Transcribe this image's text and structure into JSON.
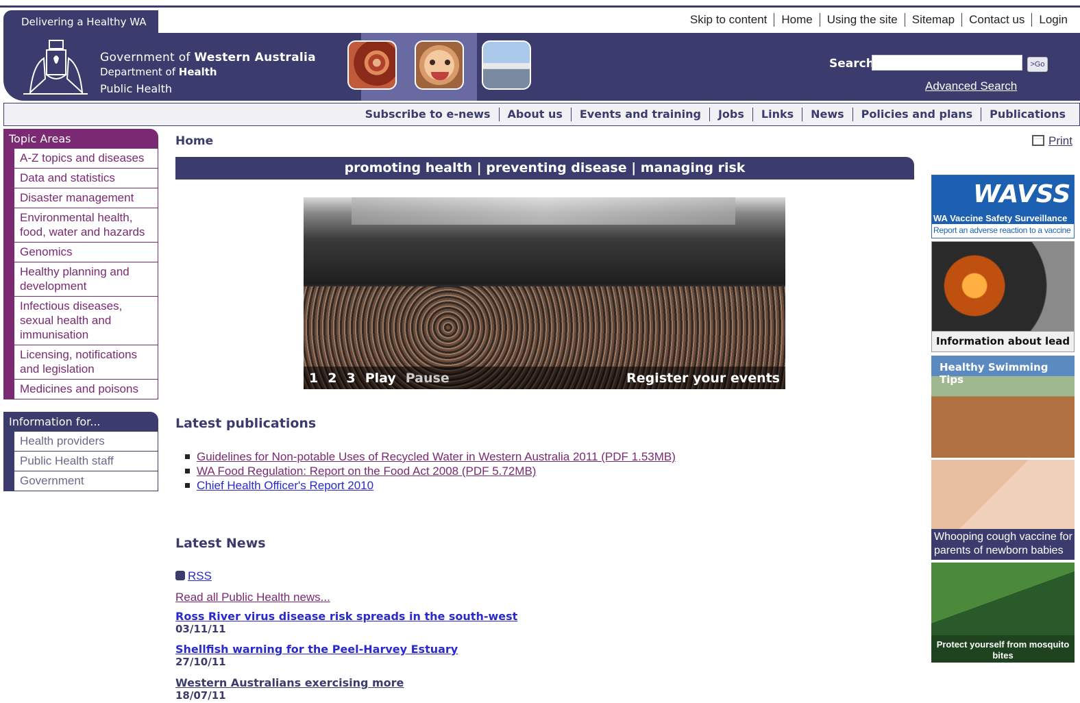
{
  "tagline": "Delivering a Healthy WA",
  "utility_nav": [
    "Skip to content",
    "Home",
    "Using the site",
    "Sitemap",
    "Contact us",
    "Login"
  ],
  "header": {
    "gov_line1_prefix": "Government of ",
    "gov_line1_bold": "Western Australia",
    "gov_line2_prefix": "Department of ",
    "gov_line2_bold": "Health",
    "gov_line3": "Public Health",
    "search_label": "Search",
    "search_value": "",
    "go_label": ">Go",
    "advanced_search": "Advanced Search"
  },
  "main_nav": [
    "Subscribe to e-news",
    "About us",
    "Events and training",
    "Jobs",
    "Links",
    "News",
    "Policies and plans",
    "Publications"
  ],
  "sidebar": {
    "topic_heading": "Topic Areas",
    "topics": [
      "A-Z topics and diseases",
      "Data and statistics",
      "Disaster management",
      "Environmental health, food, water and hazards",
      "Genomics",
      "Healthy planning and development",
      "Infectious diseases, sexual health and immunisation",
      "Licensing, notifications and legislation",
      "Medicines and poisons"
    ],
    "info_heading": "Information for...",
    "info_items": [
      "Health providers",
      "Public Health staff",
      "Government"
    ]
  },
  "breadcrumb": "Home",
  "print_label": "Print",
  "slogan": "promoting health | preventing disease | managing risk",
  "slideshow": {
    "controls": [
      "1",
      "2",
      "3",
      "Play",
      "Pause"
    ],
    "caption": "Register your events"
  },
  "latest_publications": {
    "heading": "Latest publications",
    "items": [
      "Guidelines for Non-potable Uses of Recycled Water in Western Australia 2011 (PDF 1.53MB)",
      "WA Food Regulation: Report on the Food Act 2008 (PDF 5.72MB)",
      "Chief Health Officer's Report 2010"
    ]
  },
  "latest_news": {
    "heading": "Latest News",
    "rss": "RSS",
    "read_all": "Read all Public Health news...",
    "items": [
      {
        "title": "Ross River virus disease risk spreads in the south-west",
        "date": "03/11/11"
      },
      {
        "title": "Shellfish warning for the Peel-Harvey Estuary",
        "date": "27/10/11"
      },
      {
        "title": "Western Australians exercising more",
        "date": "18/07/11"
      }
    ]
  },
  "promos": {
    "wavss_logo": "WAVSS",
    "wavss_title": "WA Vaccine Safety Surveillance",
    "wavss_sub": "Report an adverse reaction to a vaccine",
    "lead": "Information about lead",
    "swim": "Healthy Swimming Tips",
    "whoop": "Whooping cough vaccine for parents of newborn babies",
    "mosq": "Protect yourself from mosquito bites"
  }
}
